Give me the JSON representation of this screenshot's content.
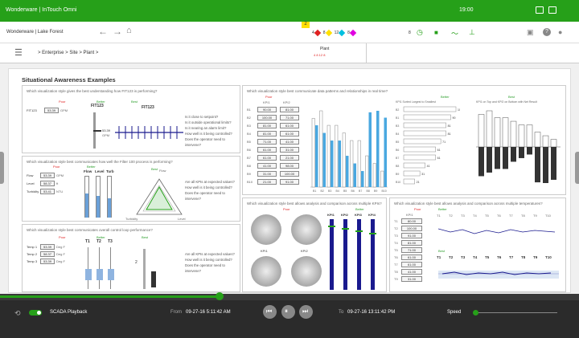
{
  "topbar": {
    "title": "Wonderware | InTouch Omni",
    "time": "19:00"
  },
  "nav": {
    "brand": "Wonderware | Lake Forest",
    "alarm_count": "2",
    "alarms": [
      {
        "n": "4",
        "c": "#e02020"
      },
      {
        "n": "8",
        "c": "#ffe000"
      },
      {
        "n": "12",
        "c": "#00c0e0"
      },
      {
        "n": "8",
        "c": "#e000e0"
      }
    ],
    "count_right": "8"
  },
  "breadcrumb": {
    "path": "> Enterprise > Site > Plant >",
    "plant_title": "Plant",
    "plant_alarms": "4  8 12  8"
  },
  "main": {
    "title": "Situational Awareness Examples",
    "p1": {
      "q": "Which visualization style gives the best understanding how FIT123 is performing?",
      "poor": "Poor",
      "better": "Better",
      "best": "Best",
      "tag": "FIT123",
      "tag2": "FIT123",
      "tag3": "FIT123",
      "value": "53.39",
      "unit": "GPM",
      "val2": "53.39",
      "unit2": "GPM",
      "questions": [
        "Is it close to setpoint?",
        "Is it outside operational limits?",
        "Is it nearing an alarm limit?",
        "How well is it being controlled?",
        "Does the operator need to intervene?"
      ]
    },
    "p2": {
      "q": "Which visualization style best communicates how well the Filter 100 process is performing?",
      "poor": "Poor",
      "better": "Better",
      "best": "Best",
      "rows": [
        {
          "l": "Flow",
          "v": "53.39",
          "u": "GPM"
        },
        {
          "l": "Level",
          "v": "58.37",
          "u": "ft"
        },
        {
          "l": "Turbidity",
          "v": "53.41",
          "u": "NTU"
        }
      ],
      "cols": [
        "Flow",
        "Level",
        "Turb"
      ],
      "radar": [
        "Flow",
        "Turbidity",
        "Level"
      ],
      "questions": [
        "Are all KPIs at expected values?",
        "How well is it being controlled?",
        "Does the operator need to intervene?"
      ]
    },
    "p3": {
      "q": "Which visualization style best communicates overall control loop performance?",
      "poor": "Poor",
      "better": "Better",
      "best": "Best",
      "rows": [
        {
          "l": "Temp 1",
          "v": "53.39",
          "u": "Deg F"
        },
        {
          "l": "Temp 2",
          "v": "58.37",
          "u": "Deg F"
        },
        {
          "l": "Temp 3",
          "v": "53.39",
          "u": "Deg F"
        }
      ],
      "cols": [
        "T1",
        "T2",
        "T3"
      ],
      "num": "2",
      "questions": [
        "Are all KPIs at expected values?",
        "How well is it being controlled?",
        "Does the operator need to intervene?"
      ]
    },
    "p4": {
      "q": "Which visualization style best communicate data patterns and relationships in real time?",
      "poor": "Poor",
      "better": "Better",
      "best": "Best",
      "kpi1": "KPI1",
      "kpi2": "KPI2",
      "rows": [
        [
          "B1",
          "90.00",
          "81.00"
        ],
        [
          "B2",
          "100.00",
          "71.00"
        ],
        [
          "B3",
          "81.00",
          "61.00"
        ],
        [
          "B4",
          "81.00",
          "61.00"
        ],
        [
          "B5",
          "71.00",
          "41.00"
        ],
        [
          "B6",
          "61.00",
          "31.00"
        ],
        [
          "B7",
          "61.00",
          "21.00"
        ],
        [
          "B8",
          "41.00",
          "98.00"
        ],
        [
          "B9",
          "31.00",
          "100.00"
        ],
        [
          "B10",
          "21.00",
          "91.00"
        ]
      ],
      "bar_vals": [
        [
          90,
          81
        ],
        [
          100,
          71
        ],
        [
          81,
          61
        ],
        [
          81,
          61
        ],
        [
          71,
          41
        ],
        [
          61,
          31
        ],
        [
          61,
          21
        ],
        [
          41,
          98
        ],
        [
          31,
          100
        ],
        [
          21,
          91
        ]
      ],
      "note1": "KPI1 Sorted Largest to Smallest",
      "note2": "KPI1 on Top and KPI2 on Bottom with Net Result"
    },
    "p5": {
      "q": "Which visualization style best allows analysis and comparison across multiple KPIs?",
      "poor": "Poor",
      "better": "Better",
      "gauges": [
        "KPI1",
        "KPI2",
        "KPI3",
        "KPI4"
      ],
      "kpis": [
        "KPI1",
        "KPI2",
        "KPI3",
        "KPI4"
      ]
    },
    "p6": {
      "q": "Which visualization style best allows analysis and comparison across multiple temperatures?",
      "poor": "Poor",
      "better": "Better",
      "best": "Best",
      "tcols": [
        "T1",
        "T2",
        "T3",
        "T4",
        "T5",
        "T6",
        "T7",
        "T8",
        "T9",
        "T10"
      ],
      "rows": [
        [
          "T1",
          "80.00"
        ],
        [
          "T2",
          "100.00"
        ],
        [
          "T3",
          "91.00"
        ],
        [
          "T4",
          "81.00"
        ],
        [
          "T5",
          "71.00"
        ],
        [
          "T6",
          "61.00"
        ],
        [
          "T7",
          "61.00"
        ],
        [
          "T8",
          "41.00"
        ],
        [
          "T9",
          "31.00"
        ]
      ],
      "kpi": "KPI1"
    }
  },
  "playback": {
    "label": "SCADA Playback",
    "from_label": "From",
    "from": "09-27-16 5:11:42 AM",
    "to_label": "To",
    "to": "09-27-16 13:11:42 PM",
    "speed": "Speed"
  }
}
